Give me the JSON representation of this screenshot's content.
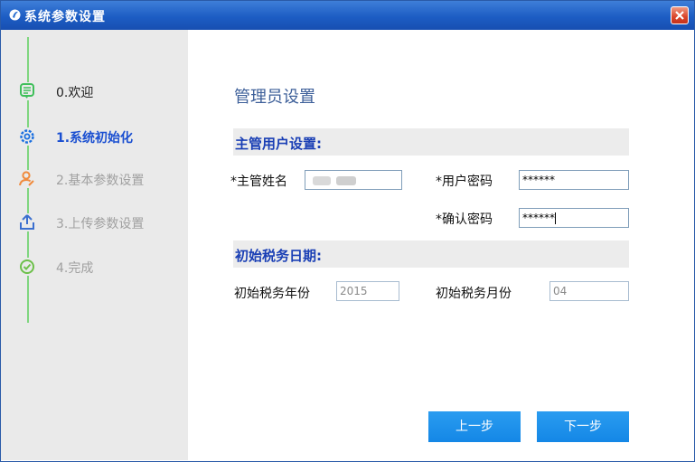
{
  "window": {
    "title": "系统参数设置"
  },
  "sidebar": {
    "steps": [
      {
        "label": "0.欢迎",
        "icon": "message-icon",
        "state": "done"
      },
      {
        "label": "1.系统初始化",
        "icon": "gear-icon",
        "state": "active"
      },
      {
        "label": "2.基本参数设置",
        "icon": "user-edit-icon",
        "state": "todo"
      },
      {
        "label": "3.上传参数设置",
        "icon": "upload-icon",
        "state": "todo"
      },
      {
        "label": "4.完成",
        "icon": "check-circle-icon",
        "state": "todo"
      }
    ]
  },
  "main": {
    "title": "管理员设置",
    "section_supervisor": "主管用户设置:",
    "supervisor_name_label": "*主管姓名",
    "supervisor_name_value": "",
    "user_password_label": "*用户密码",
    "user_password_value": "******",
    "confirm_password_label": "*确认密码",
    "confirm_password_value": "******",
    "section_tax_date": "初始税务日期:",
    "tax_year_label": "初始税务年份",
    "tax_year_value": "2015",
    "tax_month_label": "初始税务月份",
    "tax_month_value": "04"
  },
  "buttons": {
    "prev": "上一步",
    "next": "下一步"
  },
  "colors": {
    "active_step": "#1a4fd1",
    "section_text": "#1a3fb5",
    "button_bg": "#1487e6",
    "title_bar": "#1d5dc4",
    "progress_track": "#7fd67f"
  }
}
